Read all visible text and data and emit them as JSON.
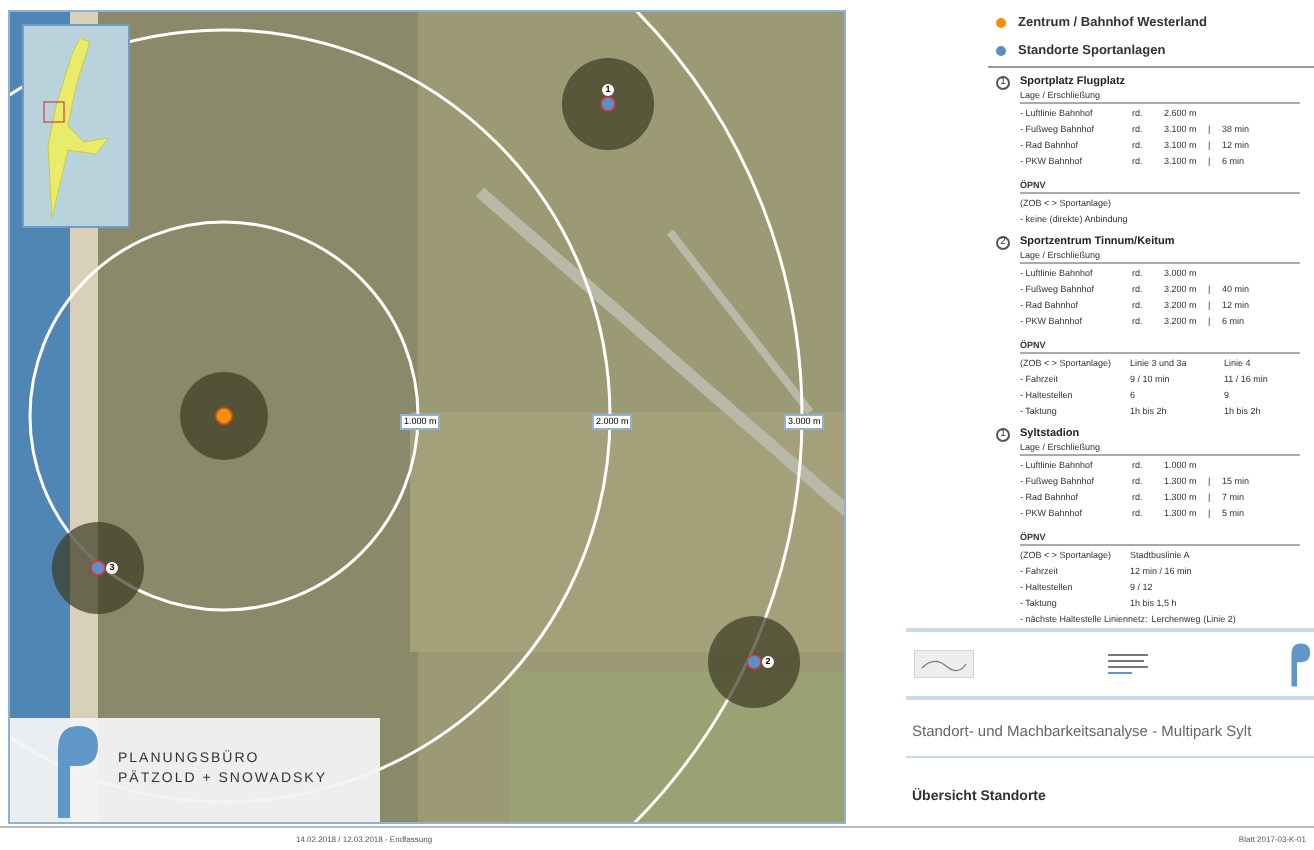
{
  "map": {
    "rings": [
      {
        "label": "1.000 m"
      },
      {
        "label": "2.000 m"
      },
      {
        "label": "3.000 m"
      }
    ],
    "markers": [
      {
        "number": "1",
        "kind": "site"
      },
      {
        "number": "2",
        "kind": "site"
      },
      {
        "number": "3",
        "kind": "site"
      },
      {
        "kind": "center"
      }
    ],
    "logo": {
      "line1": "PLANUNGSBÜRO",
      "line2": "PÄTZOLD + SNOWADSKY"
    }
  },
  "legend": [
    {
      "label": "Zentrum / Bahnhof Westerland",
      "color": "#f39200"
    },
    {
      "label": "Standorte Sportanlagen",
      "color": "#5b8fc7"
    }
  ],
  "sites": [
    {
      "number": "1",
      "name": "Sportplatz Flugplatz",
      "lage_heading": "Lage / Erschließung",
      "distances": [
        [
          "- Luftlinie Bahnhof",
          "rd.",
          "2.600 m"
        ],
        [
          "- Fußweg Bahnhof",
          "rd.",
          "3.100 m",
          "|",
          "38 min"
        ],
        [
          "- Rad Bahnhof",
          "rd.",
          "3.100 m",
          "|",
          "12 min"
        ],
        [
          "- PKW Bahnhof",
          "rd.",
          "3.100 m",
          "|",
          "6 min"
        ]
      ],
      "opnv_heading": "ÖPNV",
      "opnv": [
        [
          "(ZOB < > Sportanlage)"
        ],
        [
          "- keine (direkte) Anbindung"
        ]
      ]
    },
    {
      "number": "2",
      "name": "Sportzentrum Tinnum/Keitum",
      "lage_heading": "Lage / Erschließung",
      "distances": [
        [
          "- Luftlinie Bahnhof",
          "rd.",
          "3.000 m"
        ],
        [
          "- Fußweg Bahnhof",
          "rd.",
          "3.200 m",
          "|",
          "40 min"
        ],
        [
          "- Rad Bahnhof",
          "rd.",
          "3.200 m",
          "|",
          "12 min"
        ],
        [
          "- PKW Bahnhof",
          "rd.",
          "3.200 m",
          "|",
          "6 min"
        ]
      ],
      "opnv_heading": "ÖPNV",
      "opnv": [
        [
          "(ZOB < > Sportanlage)",
          "Linie 3 und 3a",
          "Linie 4"
        ],
        [
          "- Fahrzeit",
          "9 / 10 min",
          "11 / 16 min"
        ],
        [
          "- Haltestellen",
          "6",
          "9"
        ],
        [
          "- Taktung",
          "1h bis 2h",
          "1h bis 2h"
        ]
      ]
    },
    {
      "number": "1",
      "name": "Syltstadion",
      "lage_heading": "Lage / Erschließung",
      "distances": [
        [
          "- Luftlinie Bahnhof",
          "rd.",
          "1.000 m"
        ],
        [
          "- Fußweg Bahnhof",
          "rd.",
          "1.300 m",
          "|",
          "15 min"
        ],
        [
          "- Rad Bahnhof",
          "rd.",
          "1.300 m",
          "|",
          "7 min"
        ],
        [
          "- PKW Bahnhof",
          "rd.",
          "1.300 m",
          "|",
          "5 min"
        ]
      ],
      "opnv_heading": "ÖPNV",
      "opnv": [
        [
          "(ZOB < > Sportanlage)",
          "Stadtbuslinie A"
        ],
        [
          "- Fahrzeit",
          "12 min / 16 min"
        ],
        [
          "- Haltestellen",
          "9 / 12"
        ],
        [
          "- Taktung",
          "1h bis 1,5 h"
        ],
        [
          "- nächste Haltestelle Liniennetz:",
          "Lerchenweg (Linie 2)"
        ]
      ]
    }
  ],
  "project_title": "Standort- und Machbarkeitsanalyse - Multipark Sylt",
  "sheet_title": "Übersicht Standorte",
  "footer": {
    "date": "14.02.2018 / 12.03.2018 - Endfassung",
    "sheet": "Blatt 2017-03-K-01"
  }
}
